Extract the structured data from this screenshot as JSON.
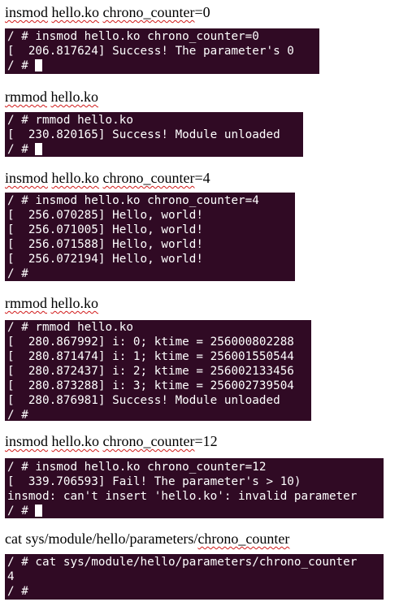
{
  "sections": [
    {
      "caption_parts": [
        {
          "text": "insmod",
          "squiggle": true
        },
        {
          "text": " ",
          "squiggle": false
        },
        {
          "text": "hello.ko",
          "squiggle": true
        },
        {
          "text": " ",
          "squiggle": false
        },
        {
          "text": "chrono_counter",
          "squiggle": true
        },
        {
          "text": "=0",
          "squiggle": false
        }
      ],
      "terminal_lines": [
        "/ # insmod hello.ko chrono_counter=0",
        "[  206.817624] Success! The parameter's 0",
        "/ # "
      ],
      "cursor": true
    },
    {
      "caption_parts": [
        {
          "text": "rmmod",
          "squiggle": true
        },
        {
          "text": " ",
          "squiggle": false
        },
        {
          "text": "hello.ko",
          "squiggle": true
        }
      ],
      "terminal_lines": [
        "/ # rmmod hello.ko",
        "[  230.820165] Success! Module unloaded",
        "/ # "
      ],
      "cursor": true
    },
    {
      "caption_parts": [
        {
          "text": "insmod",
          "squiggle": true
        },
        {
          "text": " ",
          "squiggle": false
        },
        {
          "text": "hello.ko",
          "squiggle": true
        },
        {
          "text": " ",
          "squiggle": false
        },
        {
          "text": "chrono_counter",
          "squiggle": true
        },
        {
          "text": "=4",
          "squiggle": false
        }
      ],
      "terminal_lines": [
        "/ # insmod hello.ko chrono_counter=4",
        "[  256.070285] Hello, world!",
        "[  256.071005] Hello, world!",
        "[  256.071588] Hello, world!",
        "[  256.072194] Hello, world!",
        "/ #"
      ],
      "cursor": false
    },
    {
      "caption_parts": [
        {
          "text": "rmmod",
          "squiggle": true
        },
        {
          "text": " ",
          "squiggle": false
        },
        {
          "text": "hello.ko",
          "squiggle": true
        }
      ],
      "terminal_lines": [
        "/ # rmmod hello.ko",
        "[  280.867992] i: 0; ktime = 256000802288",
        "[  280.871474] i: 1; ktime = 256001550544",
        "[  280.872437] i: 2; ktime = 256002133456",
        "[  280.873288] i: 3; ktime = 256002739504",
        "[  280.876981] Success! Module unloaded",
        "/ #"
      ],
      "cursor": false
    },
    {
      "caption_parts": [
        {
          "text": "insmod",
          "squiggle": true
        },
        {
          "text": " ",
          "squiggle": false
        },
        {
          "text": "hello.ko",
          "squiggle": true
        },
        {
          "text": " ",
          "squiggle": false
        },
        {
          "text": "chrono_counter",
          "squiggle": true
        },
        {
          "text": "=12",
          "squiggle": false
        }
      ],
      "terminal_lines": [
        "/ # insmod hello.ko chrono_counter=12",
        "[  339.706593] Fail! The parameter's > 10)",
        "insmod: can't insert 'hello.ko': invalid parameter",
        "/ # "
      ],
      "cursor": true
    },
    {
      "caption_parts": [
        {
          "text": "cat sys/module/hello/parameters/",
          "squiggle": false
        },
        {
          "text": "chrono_counter",
          "squiggle": true
        }
      ],
      "terminal_lines": [
        "/ # cat sys/module/hello/parameters/chrono_counter",
        "4",
        "/ #"
      ],
      "cursor": false
    }
  ],
  "colors": {
    "terminal_background": "#300a24",
    "terminal_text": "#ffffff",
    "spellcheck_squiggle": "#d11a1a"
  }
}
